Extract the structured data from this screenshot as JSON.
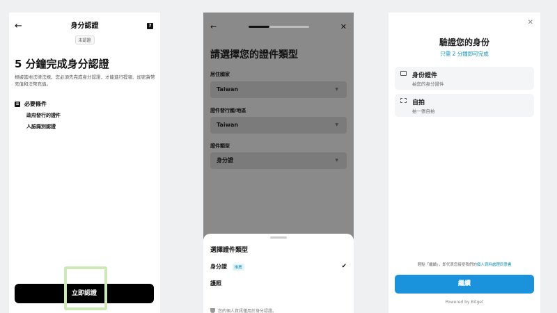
{
  "screen1": {
    "title": "身分認證",
    "badge": "未認證",
    "heading": "5 分鐘完成身分認證",
    "description": "根據當地法律法規，您必須先完成身分認證，才能進行提領、加密貨幣充值和法幣充值。",
    "requirements_title": "必要條件",
    "requirements": [
      "政府發行的證件",
      "人臉識別認證"
    ],
    "cta": "立即認證"
  },
  "screen2": {
    "title": "請選擇您的證件類型",
    "progress": 0.35,
    "fields": [
      {
        "label": "居住國家",
        "value": "Taiwan"
      },
      {
        "label": "證件發行國/地區",
        "value": "Taiwan"
      },
      {
        "label": "證件類型",
        "value": "身分證"
      }
    ],
    "sheet": {
      "title": "選擇證件類型",
      "options": [
        {
          "label": "身分證",
          "tag": "推薦",
          "selected": true
        },
        {
          "label": "護照",
          "tag": "",
          "selected": false
        }
      ],
      "privacy": "您的個人資訊僅用於身分認證。"
    }
  },
  "screen3": {
    "title": "驗證您的身份",
    "subtitle": "只需 2 分鐘即可完成",
    "cards": [
      {
        "title": "身份證件",
        "sub": "拍您的身分證件"
      },
      {
        "title": "自拍",
        "sub": "拍一張自拍"
      }
    ],
    "consent_prefix": "輕點「繼續」，即代表您接受我們的",
    "consent_link": "個人資料處理同意書",
    "continue": "繼續",
    "powered": "Powered by Bitget"
  },
  "colors": {
    "accent": "#1a93dc",
    "link": "#0a8fb0",
    "highlight": "#cfe8b8"
  }
}
